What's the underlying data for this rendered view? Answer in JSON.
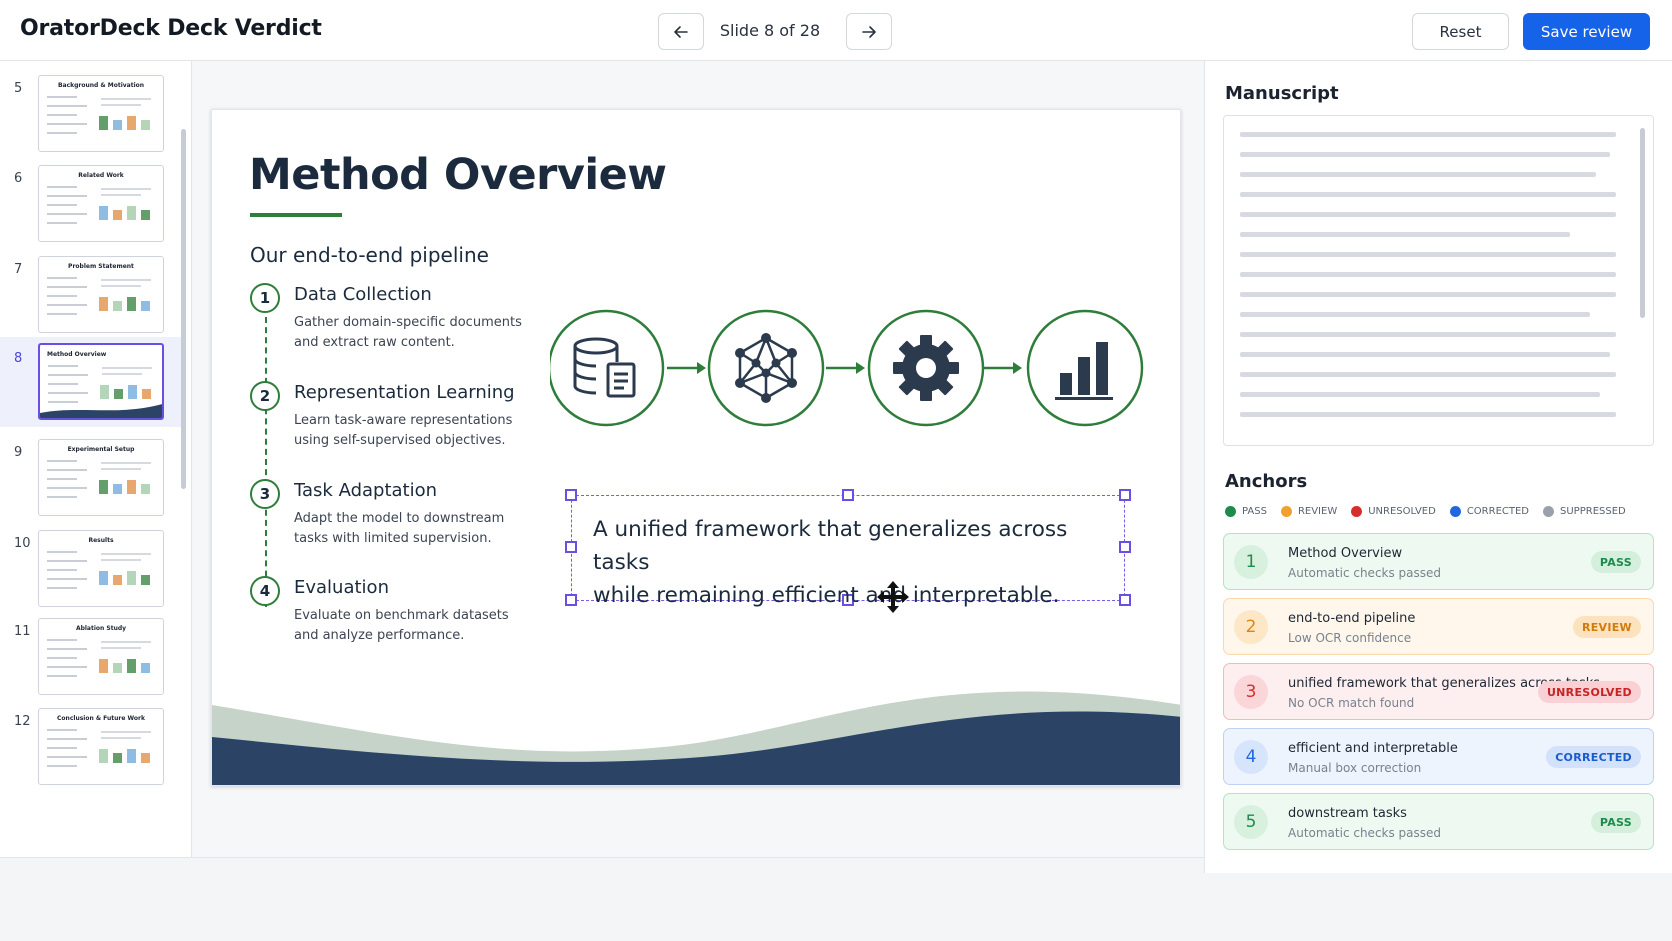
{
  "header": {
    "title": "OratorDeck Deck Verdict",
    "slide_counter": "Slide 8 of 28",
    "reset_label": "Reset",
    "save_label": "Save review",
    "accent": "#1463e8"
  },
  "thumbnails": [
    {
      "number": "5",
      "title": "Background & Motivation"
    },
    {
      "number": "6",
      "title": "Related Work"
    },
    {
      "number": "7",
      "title": "Problem Statement"
    },
    {
      "number": "8",
      "title": "Method Overview",
      "active": true
    },
    {
      "number": "9",
      "title": "Experimental Setup"
    },
    {
      "number": "10",
      "title": "Results"
    },
    {
      "number": "11",
      "title": "Ablation Study"
    },
    {
      "number": "12",
      "title": "Conclusion & Future Work"
    }
  ],
  "slide": {
    "title": "Method Overview",
    "subtitle": "Our end-to-end pipeline",
    "steps": [
      {
        "number": "1",
        "title": "Data Collection",
        "desc_line1": "Gather domain-specific documents",
        "desc_line2": "and extract raw content."
      },
      {
        "number": "2",
        "title": "Representation Learning",
        "desc_line1": "Learn task-aware representations",
        "desc_line2": "using self-supervised objectives."
      },
      {
        "number": "3",
        "title": "Task Adaptation",
        "desc_line1": "Adapt the model to downstream",
        "desc_line2": "tasks with limited supervision."
      },
      {
        "number": "4",
        "title": "Evaluation",
        "desc_line1": "Evaluate on benchmark datasets",
        "desc_line2": "and analyze performance."
      }
    ],
    "pipeline_icons": [
      "database-document-icon",
      "network-graph-icon",
      "gear-icon",
      "bar-chart-icon"
    ],
    "quote_line1": "A unified framework that generalizes across tasks",
    "quote_line2": "while remaining efficient and interpretable.",
    "accent_green": "#2f7d3a",
    "accent_navy": "#2b4466"
  },
  "manuscript": {
    "heading": "Manuscript"
  },
  "anchors": {
    "heading": "Anchors",
    "legend": [
      {
        "label": "PASS",
        "color": "#1f8a4c"
      },
      {
        "label": "REVIEW",
        "color": "#f0a030"
      },
      {
        "label": "UNRESOLVED",
        "color": "#d62d2d"
      },
      {
        "label": "CORRECTED",
        "color": "#2167e0"
      },
      {
        "label": "SUPPRESSED",
        "color": "#9aa1ad"
      }
    ],
    "items": [
      {
        "number": "1",
        "title": "Method Overview",
        "subtitle": "Automatic checks passed",
        "status": "PASS"
      },
      {
        "number": "2",
        "title": "end-to-end pipeline",
        "subtitle": "Low OCR confidence",
        "status": "REVIEW"
      },
      {
        "number": "3",
        "title": "unified framework that generalizes across tasks",
        "subtitle": "No OCR match found",
        "status": "UNRESOLVED"
      },
      {
        "number": "4",
        "title": "efficient and interpretable",
        "subtitle": "Manual box correction",
        "status": "CORRECTED"
      },
      {
        "number": "5",
        "title": "downstream tasks",
        "subtitle": "Automatic checks passed",
        "status": "PASS"
      }
    ]
  }
}
